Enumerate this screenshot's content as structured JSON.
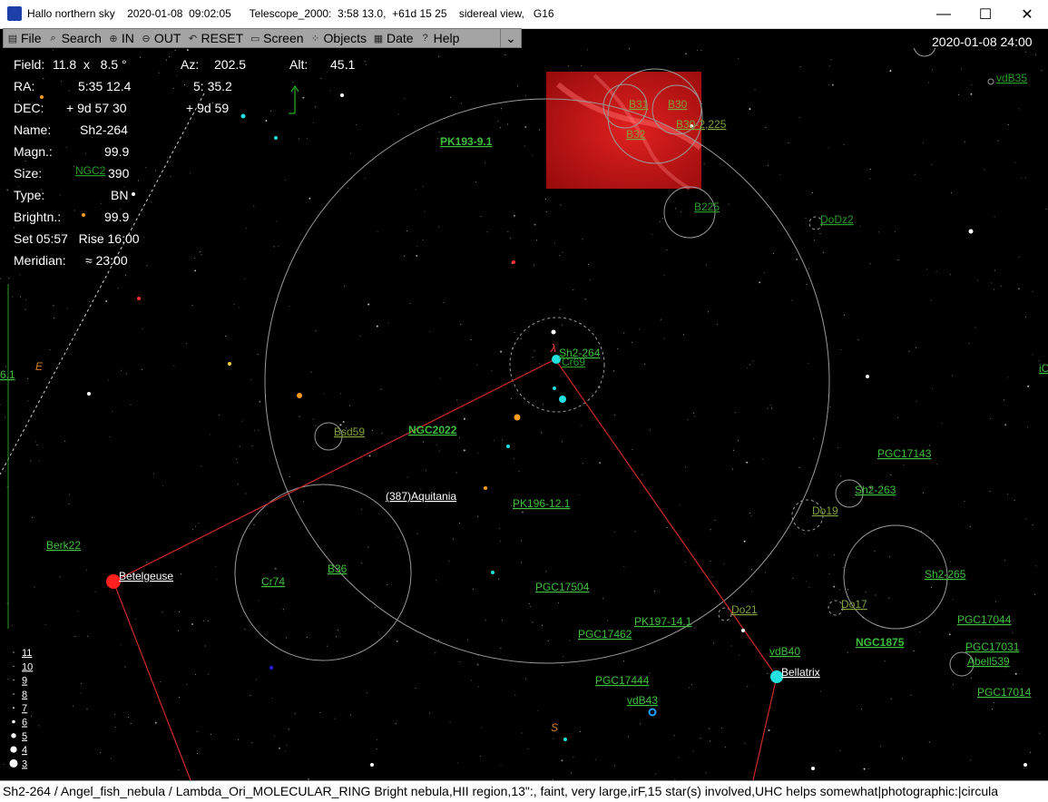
{
  "window": {
    "title": "Hallo northern sky",
    "date": "2020-01-08",
    "time": "09:02:05",
    "telescope": "Telescope_2000:  3:58 13.0,  +61d 15 25",
    "view": "sidereal view,",
    "viewcode": "G16",
    "minimize": "—",
    "maximize": "☐",
    "close": "✕"
  },
  "toolbar": [
    {
      "name": "file",
      "icon": "folder-icon",
      "glyph": "▤",
      "label": "File"
    },
    {
      "name": "search",
      "icon": "binoculars-icon",
      "glyph": "⌕",
      "label": "Search"
    },
    {
      "name": "in",
      "icon": "zoom-in-icon",
      "glyph": "⊕",
      "label": "IN"
    },
    {
      "name": "out",
      "icon": "zoom-out-icon",
      "glyph": "⊖",
      "label": "OUT"
    },
    {
      "name": "reset",
      "icon": "reset-icon",
      "glyph": "↶",
      "label": "RESET"
    },
    {
      "name": "screen",
      "icon": "monitor-icon",
      "glyph": "▭",
      "label": "Screen"
    },
    {
      "name": "objects",
      "icon": "objects-icon",
      "glyph": "⁘",
      "label": "Objects"
    },
    {
      "name": "date",
      "icon": "calendar-icon",
      "glyph": "▦",
      "label": "Date"
    },
    {
      "name": "help",
      "icon": "help-icon",
      "glyph": "?",
      "label": "Help"
    }
  ],
  "toolbar_dropdown": "⌄",
  "info": {
    "field_label": "Field:",
    "field_value": "11.8  x   8.5 °",
    "az_label": "Az:",
    "az_value": "202.5",
    "alt_label": "Alt:",
    "alt_value": "45.1",
    "ra_label": "RA:",
    "ra_value": "5:35 12.4",
    "ra_value2": "5: 35.2",
    "dec_label": "DEC:",
    "dec_value": "+ 9d 57 30",
    "dec_value2": "+ 9d 59",
    "name_label": "Name:",
    "name_value": "Sh2-264",
    "magn_label": "Magn.:",
    "magn_value": "99.9",
    "size_label": "Size:",
    "size_value": "390",
    "type_label": "Type:",
    "type_value": "BN",
    "bright_label": "Brightn.:",
    "bright_value": "99.9",
    "set_rise": "Set 05:57   Rise 16:00",
    "meridian_label": "Meridian:",
    "meridian_value": "≈ 23:00"
  },
  "sky_date": "2020-01-08  24:00",
  "labels": {
    "pk193": "PK193-9.1",
    "b31": "B31",
    "b30": "B30",
    "b302": "B30-2,225",
    "b32": "B32",
    "b225": "B225",
    "dodz2": "DoDz2",
    "vdb35": "vdB35",
    "ngc2": "NGC2",
    "sh2264": "Sh2-264",
    "cr69": "Cr69",
    "ngc2022": "NGC2022",
    "bsd": "Bsd59",
    "pgc17143": "PGC17143",
    "sh2263": "Sh2-263",
    "do19": "Do19",
    "aquitania": "(387)Aquitania",
    "pk196": "PK196-12.1",
    "berk22": "Berk22",
    "betelgeuse": "Betelgeuse",
    "cr74": "Cr74",
    "b36": "B36",
    "pgc17504": "PGC17504",
    "sh2265": "Sh2-265",
    "do21": "Do21",
    "do17": "Do17",
    "pk197": "PK197-14.1",
    "pgc17462": "PGC17462",
    "pgc17044": "PGC17044",
    "vdb40": "vdB40",
    "ngc1875": "NGC1875",
    "pgc17031": "PGC17031",
    "abell539": "Abell539",
    "bellatrix": "Bellatrix",
    "pgc17444": "PGC17444",
    "vdb43": "vdB43",
    "pgc17014": "PGC17014",
    "edge61": "6.1",
    "edgec": "iC",
    "lambda": "λ",
    "e": "E",
    "s": "S"
  },
  "mag_scale": [
    "11",
    "10",
    "9",
    "8",
    "7",
    "6",
    "5",
    "4",
    "3"
  ],
  "statusbar": "Sh2-264 / Angel_fish_nebula / Lambda_Ori_MOLECULAR_RING   Bright nebula,HII region,13\":, faint, very large,irF,15 star(s)  involved,UHC helps somewhat|photographic:|circula",
  "colors": {
    "label_green": "#3fbf3f",
    "star_cyan": "#22e0e0",
    "betelgeuse": "#ff2020",
    "line_red": "#cc2a2a"
  }
}
